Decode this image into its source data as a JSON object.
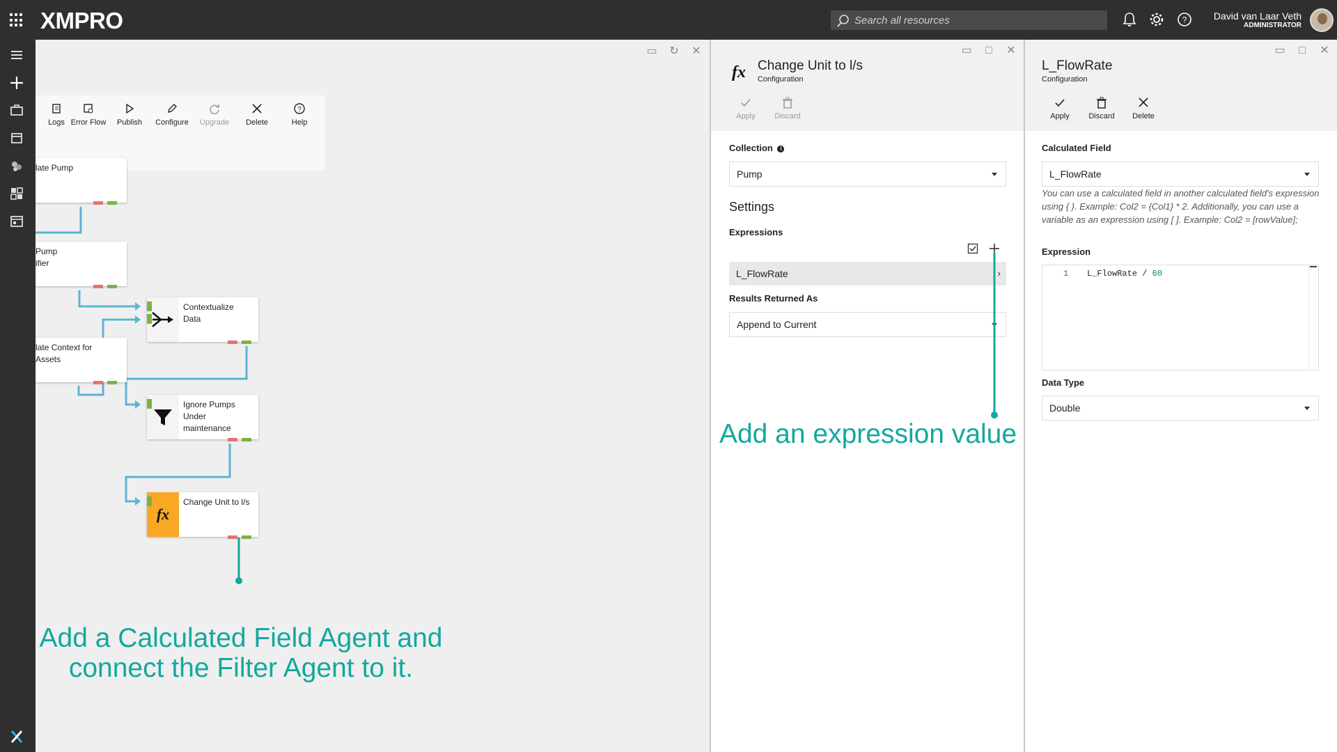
{
  "app": {
    "logo": "XMPRO",
    "search_placeholder": "Search all resources",
    "user_name": "David van Laar Veth",
    "user_role": "ADMINISTRATOR"
  },
  "canvas": {
    "toolbar": [
      {
        "label": "Logs",
        "icon": "logs-icon",
        "enabled": true
      },
      {
        "label": "Error Flow",
        "icon": "error-flow-icon",
        "enabled": true
      },
      {
        "label": "Publish",
        "icon": "publish-icon",
        "enabled": true
      },
      {
        "label": "Configure",
        "icon": "pencil-icon",
        "enabled": true
      },
      {
        "label": "Upgrade",
        "icon": "refresh-icon",
        "enabled": false
      },
      {
        "label": "Delete",
        "icon": "close-icon",
        "enabled": true
      },
      {
        "label": "Help",
        "icon": "help-icon",
        "enabled": true
      }
    ],
    "nodes": [
      {
        "label": "late Pump"
      },
      {
        "label": "Pump ifier"
      },
      {
        "label": "late Context for Assets"
      },
      {
        "label": "Contextualize Data"
      },
      {
        "label": "Ignore Pumps Under maintenance"
      },
      {
        "label": "Change Unit to l/s"
      }
    ],
    "annotation": "Add a Calculated Field Agent and connect the Filter Agent to it."
  },
  "panel_middle": {
    "title": "Change Unit to l/s",
    "subtitle": "Configuration",
    "actions": [
      {
        "label": "Apply",
        "icon": "check-icon",
        "enabled": false
      },
      {
        "label": "Discard",
        "icon": "trash-icon",
        "enabled": false
      }
    ],
    "collection_label": "Collection",
    "collection_value": "Pump",
    "settings_heading": "Settings",
    "expressions_label": "Expressions",
    "expression_row": "L_FlowRate",
    "results_label": "Results Returned As",
    "results_value": "Append to Current",
    "annotation": "Add an expression value"
  },
  "panel_right": {
    "title": "L_FlowRate",
    "subtitle": "Configuration",
    "actions": [
      {
        "label": "Apply",
        "icon": "check-icon",
        "enabled": true
      },
      {
        "label": "Discard",
        "icon": "trash-icon",
        "enabled": true
      },
      {
        "label": "Delete",
        "icon": "close-icon",
        "enabled": true
      }
    ],
    "calculated_field_label": "Calculated Field",
    "calculated_field_value": "L_FlowRate",
    "help": "You can use a calculated field in another calculated field's expression using { }. Example: Col2 = {Col1} * 2. Additionally, you can use a variable as an expression using [ ]. Example: Col2 = [rowValue];",
    "expression_label": "Expression",
    "code_line_number": "1",
    "code_prefix": "L_FlowRate / ",
    "code_number": "60",
    "data_type_label": "Data Type",
    "data_type_value": "Double"
  },
  "colors": {
    "topbar": "#2f2f2f",
    "annotation": "#13a89e",
    "connector": "#5bb4d4",
    "port_green": "#7cb342",
    "port_red": "#e57373",
    "fx_tile": "#f9a825"
  }
}
